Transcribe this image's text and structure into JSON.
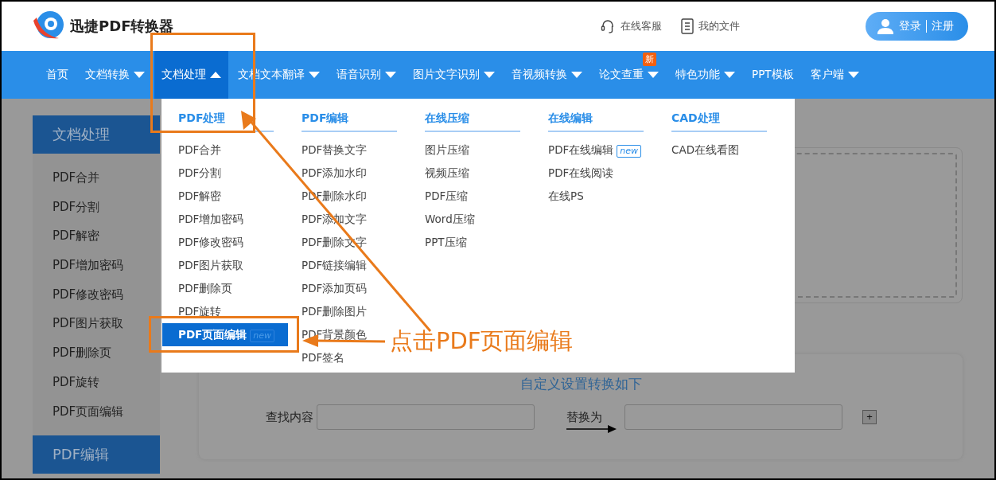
{
  "header": {
    "logo_text": "迅捷PDF转换器",
    "links": [
      {
        "kind": "headset",
        "label": "在线客服"
      },
      {
        "kind": "file",
        "label": "我的文件"
      }
    ],
    "login": "登录",
    "register": "注册"
  },
  "nav": [
    {
      "label": "首页",
      "caret": false,
      "selected": false
    },
    {
      "label": "文档转换",
      "caret": true,
      "selected": false
    },
    {
      "label": "文档处理",
      "caret": true,
      "selected": true
    },
    {
      "label": "文档文本翻译",
      "caret": true,
      "selected": false
    },
    {
      "label": "语音识别",
      "caret": true,
      "selected": false
    },
    {
      "label": "图片文字识别",
      "caret": true,
      "selected": false
    },
    {
      "label": "音视频转换",
      "caret": true,
      "selected": false
    },
    {
      "label": "论文查重",
      "caret": true,
      "selected": false,
      "badge": "新"
    },
    {
      "label": "特色功能",
      "caret": true,
      "selected": false
    },
    {
      "label": "PPT模板",
      "caret": false,
      "selected": false
    },
    {
      "label": "客户端",
      "caret": true,
      "selected": false
    }
  ],
  "dropdown": [
    {
      "title": "PDF处理",
      "items": [
        {
          "label": "PDF合并",
          "selected": false
        },
        {
          "label": "PDF分割",
          "selected": false
        },
        {
          "label": "PDF解密",
          "selected": false
        },
        {
          "label": "PDF增加密码",
          "selected": false
        },
        {
          "label": "PDF修改密码",
          "selected": false
        },
        {
          "label": "PDF图片获取",
          "selected": false
        },
        {
          "label": "PDF删除页",
          "selected": false
        },
        {
          "label": "PDF旋转",
          "selected": false
        },
        {
          "label": "PDF页面编辑",
          "selected": true,
          "badge": "new"
        }
      ]
    },
    {
      "title": "PDF编辑",
      "items": [
        {
          "label": "PDF替换文字",
          "selected": false
        },
        {
          "label": "PDF添加水印",
          "selected": false
        },
        {
          "label": "PDF删除水印",
          "selected": false
        },
        {
          "label": "PDF添加文字",
          "selected": false
        },
        {
          "label": "PDF删除文字",
          "selected": false
        },
        {
          "label": "PDF链接编辑",
          "selected": false
        },
        {
          "label": "PDF添加页码",
          "selected": false
        },
        {
          "label": "PDF删除图片",
          "selected": false
        },
        {
          "label": "PDF背景颜色",
          "selected": false
        },
        {
          "label": "PDF签名",
          "selected": false
        }
      ]
    },
    {
      "title": "在线压缩",
      "items": [
        {
          "label": "图片压缩",
          "selected": false
        },
        {
          "label": "视频压缩",
          "selected": false
        },
        {
          "label": "PDF压缩",
          "selected": false
        },
        {
          "label": "Word压缩",
          "selected": false
        },
        {
          "label": "PPT压缩",
          "selected": false
        }
      ]
    },
    {
      "title": "在线编辑",
      "items": [
        {
          "label": "PDF在线编辑",
          "selected": false,
          "badge": "new"
        },
        {
          "label": "PDF在线阅读",
          "selected": false
        },
        {
          "label": "在线PS",
          "selected": false
        }
      ]
    },
    {
      "title": "CAD处理",
      "items": [
        {
          "label": "CAD在线看图",
          "selected": false
        }
      ]
    }
  ],
  "sidebar": [
    {
      "title": "文档处理",
      "items": [
        "PDF合并",
        "PDF分割",
        "PDF解密",
        "PDF增加密码",
        "PDF修改密码",
        "PDF图片获取",
        "PDF删除页",
        "PDF旋转",
        "PDF页面编辑"
      ]
    },
    {
      "title": "PDF编辑"
    }
  ],
  "settings": {
    "title": "自定义设置转换如下",
    "find_label": "查找内容",
    "replace_label": "替换为",
    "add_button": "+"
  },
  "annotation": {
    "text": "点击PDF页面编辑"
  }
}
